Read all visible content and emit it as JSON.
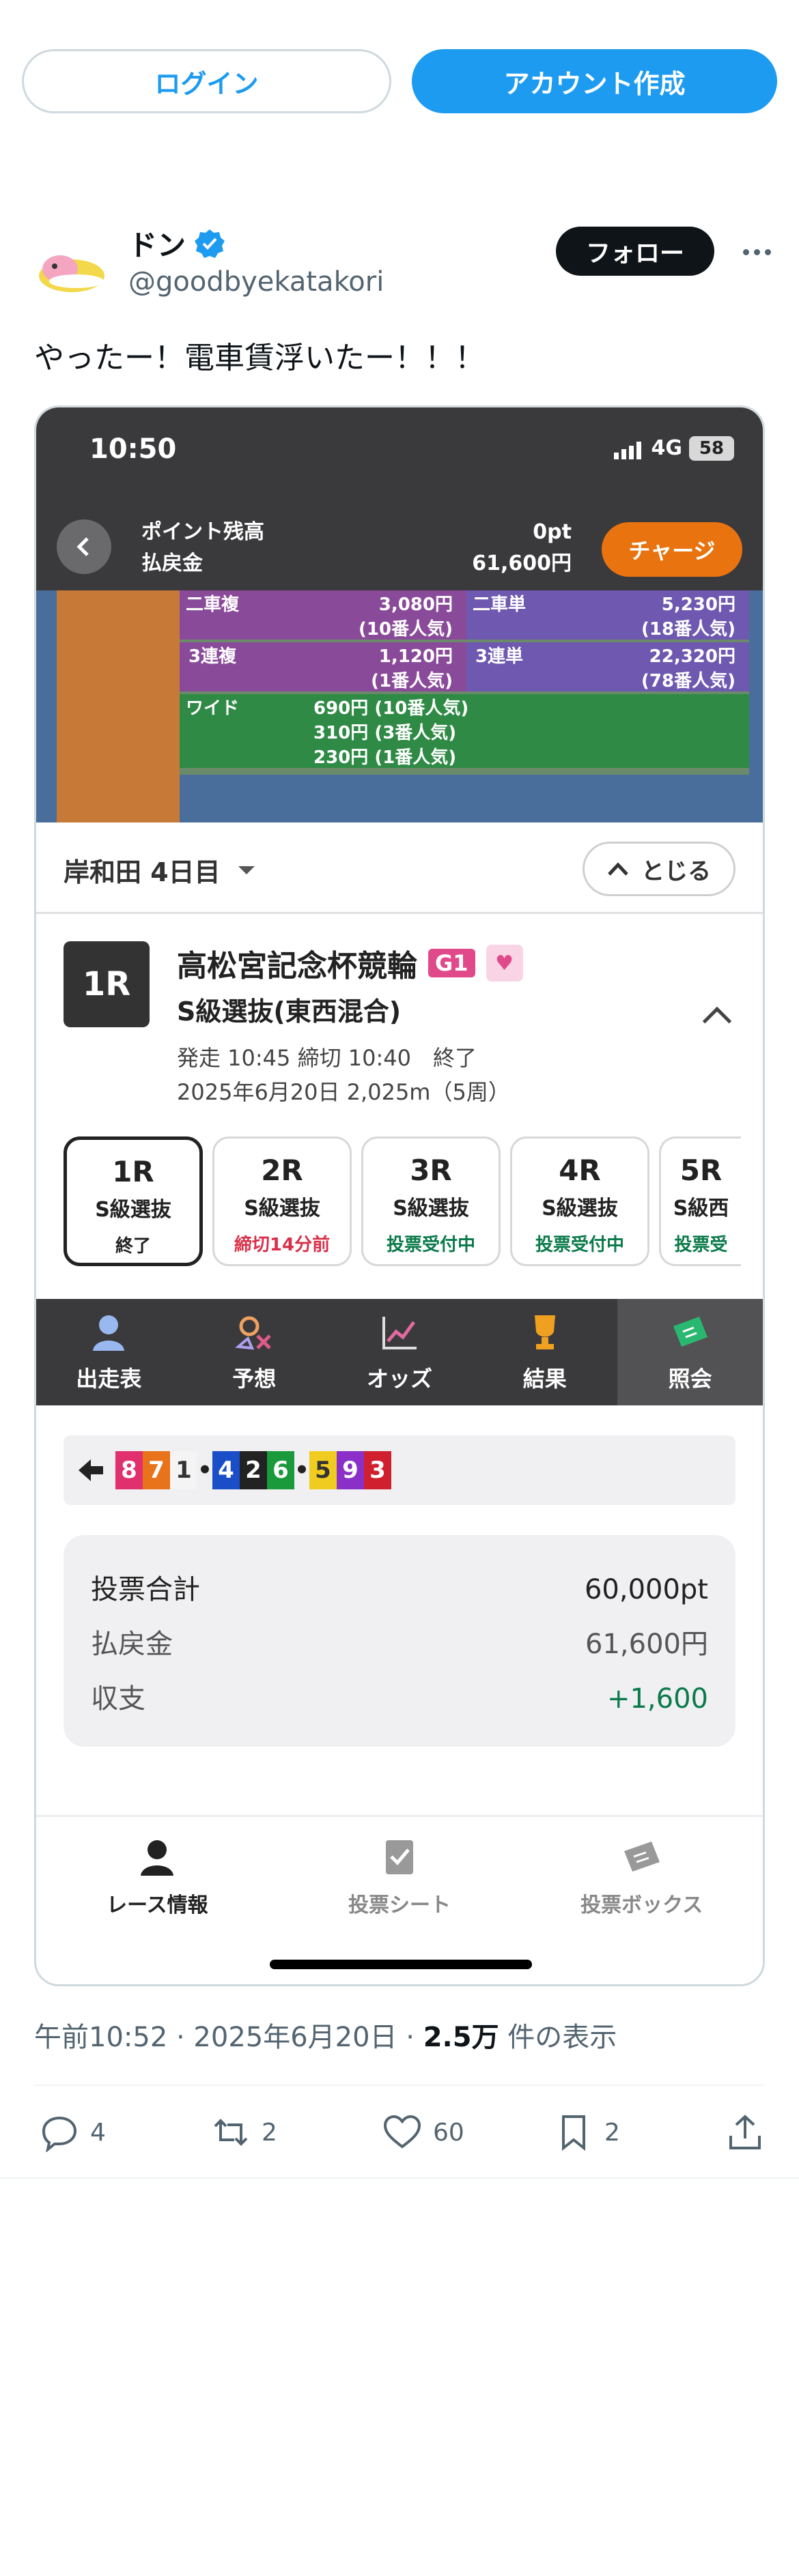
{
  "auth": {
    "login": "ログイン",
    "signup": "アカウント作成"
  },
  "tweet": {
    "display_name": "ドン",
    "handle": "@goodbyekatakori",
    "follow": "フォロー",
    "text": "やったー！電車賃浮いたー！！！",
    "timestamp": "午前10:52 · 2025年6月20日 · ",
    "views_count": "2.5万",
    "views_label": " 件の表示",
    "actions": {
      "replies": "4",
      "retweets": "2",
      "likes": "60",
      "bookmarks": "2"
    }
  },
  "screenshot": {
    "status": {
      "time": "10:50",
      "network": "4G",
      "battery": "58"
    },
    "points": {
      "label1": "ポイント残高",
      "label2": "払戻金",
      "value1": "0pt",
      "value2": "61,600円",
      "charge": "チャージ"
    },
    "video_board": [
      {
        "label": "二車複",
        "value": "3,080円"
      },
      {
        "label": "",
        "value": "(10番人気)"
      },
      {
        "label": "3連複",
        "value": "1,120円"
      },
      {
        "label": "",
        "value": "(1番人気)"
      },
      {
        "label": "ワイド",
        "value": "690円 (10番人気)"
      },
      {
        "label": "",
        "value": "310円 (3番人気)"
      },
      {
        "label": "",
        "value": "230円 (1番人気)"
      }
    ],
    "video_board_right": [
      {
        "label": "二車単",
        "value": "5,230円"
      },
      {
        "label": "",
        "value": "(18番人気)"
      },
      {
        "label": "3連単",
        "value": "22,320円"
      },
      {
        "label": "",
        "value": "(78番人気)"
      }
    ],
    "venue": {
      "title": "岸和田 4日目",
      "close": "とじる"
    },
    "race": {
      "badge": "1R",
      "name": "高松宮記念杯競輪",
      "grade": "G1",
      "class": "S級選抜(東西混合)",
      "info1": "発走 10:45 締切 10:40　終了",
      "info2": "2025年6月20日 2,025m（5周）"
    },
    "race_tabs": [
      {
        "num": "1R",
        "cls": "S級選抜",
        "status": "終了",
        "color": "#222222"
      },
      {
        "num": "2R",
        "cls": "S級選抜",
        "status": "締切14分前",
        "color": "#d9304a"
      },
      {
        "num": "3R",
        "cls": "S級選抜",
        "status": "投票受付中",
        "color": "#0a7a4a"
      },
      {
        "num": "4R",
        "cls": "S級選抜",
        "status": "投票受付中",
        "color": "#0a7a4a"
      },
      {
        "num": "5R",
        "cls": "S級西",
        "status": "投票受",
        "color": "#0a7a4a"
      }
    ],
    "nav": [
      "出走表",
      "予想",
      "オッズ",
      "結果",
      "照会"
    ],
    "result_numbers": [
      "8",
      "7",
      "1",
      "4",
      "2",
      "6",
      "5",
      "9",
      "3"
    ],
    "summary": {
      "total_label": "投票合計",
      "total_value": "60,000pt",
      "payout_label": "払戻金",
      "payout_value": "61,600円",
      "balance_label": "収支",
      "balance_value": "+1,600"
    },
    "bottom_nav": [
      "レース情報",
      "投票シート",
      "投票ボックス"
    ]
  },
  "colors": {
    "accent": "#1d9bf0",
    "charge": "#e8730f",
    "positive": "#0a7a4a",
    "grade": "#e04a8a"
  }
}
